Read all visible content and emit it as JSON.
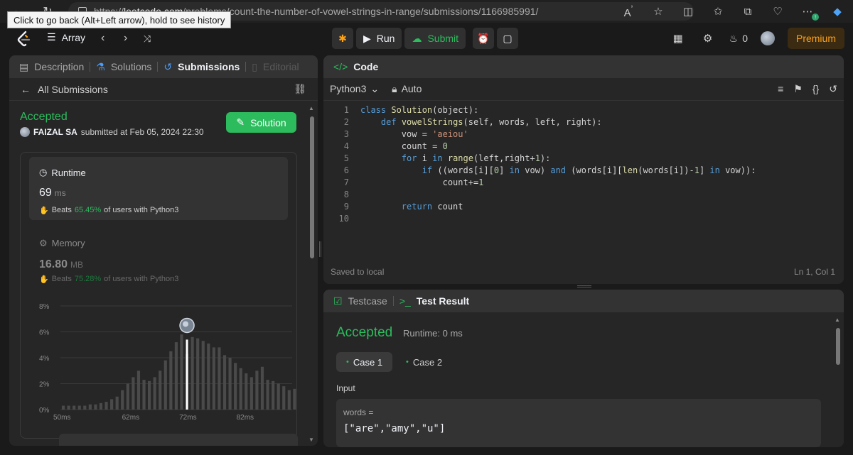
{
  "browser": {
    "url_prefix": "https://",
    "url_host": "leetcode.com",
    "url_path": "/problems/count-the-number-of-vowel-strings-in-range/submissions/1166985991/",
    "tooltip": "Click to go back (Alt+Left arrow), hold to see history"
  },
  "appbar": {
    "problem_list": "Array",
    "run_label": "Run",
    "submit_label": "Submit",
    "streak_count": "0",
    "premium_label": "Premium"
  },
  "left_tabs": {
    "description": "Description",
    "solutions": "Solutions",
    "submissions": "Submissions",
    "editorial": "Editorial"
  },
  "submission": {
    "back_label": "All Submissions",
    "status": "Accepted",
    "user": "FAIZAL SA",
    "submitted_text": "submitted at Feb 05, 2024 22:30",
    "solution_button": "Solution",
    "runtime_label": "Runtime",
    "runtime_value": "69",
    "runtime_unit": "ms",
    "runtime_beats_prefix": "Beats",
    "runtime_beats_pct": "65.45%",
    "runtime_beats_suffix": "of users with Python3",
    "memory_label": "Memory",
    "memory_value": "16.80",
    "memory_unit": "MB",
    "memory_beats_prefix": "Beats",
    "memory_beats_pct": "75.28%",
    "memory_beats_suffix": "of users with Python3"
  },
  "chart_data": {
    "type": "bar",
    "y_ticks": [
      "0%",
      "2%",
      "4%",
      "6%",
      "8%"
    ],
    "x_ticks": [
      "50ms",
      "62ms",
      "72ms",
      "82ms"
    ],
    "x_tick_values": [
      50,
      62,
      72,
      82
    ],
    "x_start": 50,
    "x_step": 0.94,
    "ylim": [
      0,
      8
    ],
    "xlim": [
      49.5,
      90
    ],
    "values": [
      0.3,
      0.3,
      0.3,
      0.3,
      0.3,
      0.4,
      0.4,
      0.5,
      0.6,
      0.8,
      1.0,
      1.5,
      2.0,
      2.5,
      3.0,
      2.3,
      2.2,
      2.5,
      3.0,
      3.8,
      4.5,
      5.2,
      5.8,
      4.3,
      5.6,
      5.5,
      5.3,
      5.1,
      4.8,
      4.8,
      4.2,
      4.0,
      3.6,
      3.2,
      2.8,
      2.5,
      3.0,
      3.3,
      2.3,
      2.2,
      2.0,
      1.8,
      1.5,
      1.6,
      1.2,
      1.0,
      0.8,
      0.7,
      0.6,
      0.4,
      0.3,
      0.3,
      0.3,
      0.3,
      0.3,
      0.2
    ],
    "highlight_value": 5.4,
    "highlight_index": 23,
    "highlight_color": "#ffffff",
    "bar_color": "#4a4a4a"
  },
  "code": {
    "tab_label": "Code",
    "language": "Python3",
    "mode": "Auto",
    "saved_text": "Saved to local",
    "cursor_pos": "Ln 1, Col 1",
    "line_numbers": [
      "1",
      "2",
      "3",
      "4",
      "5",
      "6",
      "7",
      "8",
      "9",
      "10"
    ]
  },
  "test": {
    "testcase_tab": "Testcase",
    "result_tab": "Test Result",
    "status": "Accepted",
    "runtime": "Runtime: 0 ms",
    "case1": "Case 1",
    "case2": "Case 2",
    "input_label": "Input",
    "var_name": "words =",
    "var_value": "[\"are\",\"amy\",\"u\"]"
  },
  "colors": {
    "accent_green": "#2cbb5d",
    "premium_orange": "#ffa116",
    "bg": "#1a1a1a",
    "panel": "#262626"
  }
}
